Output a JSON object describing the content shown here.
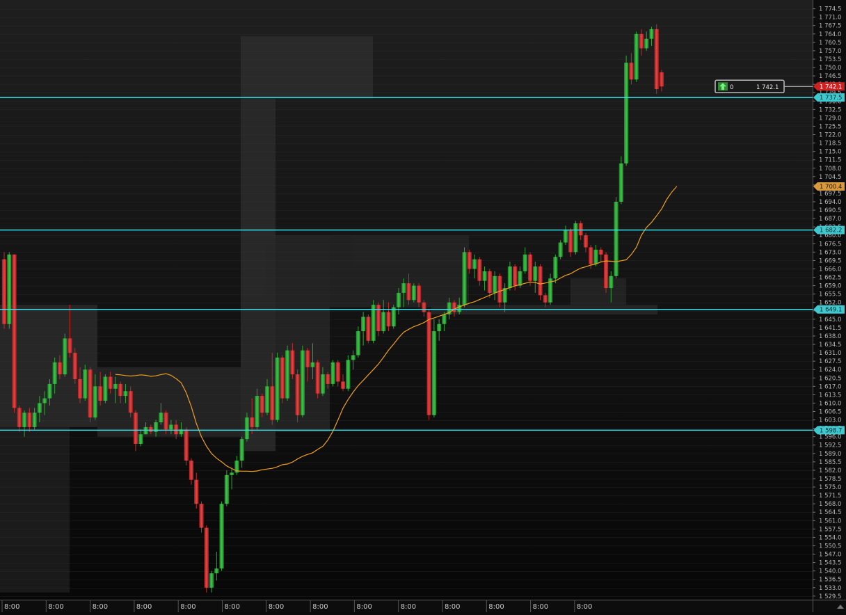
{
  "chart_data": {
    "type": "candlestick",
    "time_axis_labels": [
      "8:00",
      "8:00",
      "8:00",
      "8:00",
      "8:00",
      "8:00",
      "8:00",
      "8:00",
      "8:00",
      "8:00",
      "8:00",
      "8:00",
      "8:00",
      "8:00"
    ],
    "y_axis_ticks": [
      1774.5,
      1771.0,
      1767.5,
      1764.0,
      1760.5,
      1757.0,
      1753.5,
      1750.0,
      1746.5,
      1743.0,
      1739.5,
      1736.0,
      1732.5,
      1729.0,
      1725.5,
      1722.0,
      1718.5,
      1715.0,
      1711.5,
      1708.0,
      1704.5,
      1701.0,
      1697.5,
      1694.0,
      1690.5,
      1687.0,
      1683.5,
      1680.0,
      1676.5,
      1673.0,
      1669.5,
      1666.0,
      1662.5,
      1659.0,
      1655.5,
      1652.0,
      1648.5,
      1645.0,
      1641.5,
      1638.0,
      1634.5,
      1631.0,
      1627.5,
      1624.0,
      1620.5,
      1617.0,
      1613.5,
      1610.0,
      1606.5,
      1603.0,
      1599.5,
      1596.0,
      1592.5,
      1589.0,
      1585.5,
      1582.0,
      1578.5,
      1575.0,
      1571.5,
      1568.0,
      1564.5,
      1561.0,
      1557.5,
      1554.0,
      1550.5,
      1547.0,
      1543.5,
      1540.0,
      1536.5,
      1533.0,
      1529.5
    ],
    "ylim": [
      1528,
      1777
    ],
    "horizontal_levels": [
      1737.5,
      1682.2,
      1649.1,
      1598.7
    ],
    "horizontal_level_labels": [
      "1 737.5",
      "1 682.2",
      "1 649.1",
      "1 598.7"
    ],
    "current_price": 1742.1,
    "current_price_label": "1 742.1",
    "ma_value": 1700.4,
    "ma_value_label": "1 700.4",
    "order_widget": {
      "quantity": "0",
      "price": "1 742.1"
    },
    "colors": {
      "bull": "#27a833",
      "bear": "#d12a2a",
      "level": "#37e0e8",
      "ma": "#f0a020",
      "price_tag": "#cc2222"
    },
    "candles": [
      {
        "o": 1670,
        "h": 1673,
        "l": 1641,
        "c": 1643
      },
      {
        "o": 1643,
        "h": 1673,
        "l": 1641,
        "c": 1672
      },
      {
        "o": 1672,
        "h": 1672,
        "l": 1606,
        "c": 1608
      },
      {
        "o": 1608,
        "h": 1609,
        "l": 1598,
        "c": 1600
      },
      {
        "o": 1600,
        "h": 1607,
        "l": 1596,
        "c": 1606
      },
      {
        "o": 1606,
        "h": 1608,
        "l": 1598,
        "c": 1600
      },
      {
        "o": 1600,
        "h": 1608,
        "l": 1599,
        "c": 1606
      },
      {
        "o": 1606,
        "h": 1613,
        "l": 1602,
        "c": 1610
      },
      {
        "o": 1610,
        "h": 1615,
        "l": 1605,
        "c": 1612
      },
      {
        "o": 1612,
        "h": 1620,
        "l": 1609,
        "c": 1618
      },
      {
        "o": 1618,
        "h": 1629,
        "l": 1614,
        "c": 1627
      },
      {
        "o": 1627,
        "h": 1630,
        "l": 1620,
        "c": 1622
      },
      {
        "o": 1622,
        "h": 1639,
        "l": 1621,
        "c": 1637
      },
      {
        "o": 1637,
        "h": 1651,
        "l": 1629,
        "c": 1631
      },
      {
        "o": 1631,
        "h": 1633,
        "l": 1618,
        "c": 1620
      },
      {
        "o": 1620,
        "h": 1625,
        "l": 1610,
        "c": 1612
      },
      {
        "o": 1612,
        "h": 1626,
        "l": 1611,
        "c": 1624
      },
      {
        "o": 1624,
        "h": 1625,
        "l": 1602,
        "c": 1604
      },
      {
        "o": 1604,
        "h": 1622,
        "l": 1603,
        "c": 1617
      },
      {
        "o": 1617,
        "h": 1623,
        "l": 1609,
        "c": 1611
      },
      {
        "o": 1611,
        "h": 1622,
        "l": 1610,
        "c": 1621
      },
      {
        "o": 1621,
        "h": 1623,
        "l": 1614,
        "c": 1616
      },
      {
        "o": 1616,
        "h": 1621,
        "l": 1610,
        "c": 1618
      },
      {
        "o": 1618,
        "h": 1619,
        "l": 1610,
        "c": 1613
      },
      {
        "o": 1613,
        "h": 1618,
        "l": 1610,
        "c": 1615
      },
      {
        "o": 1615,
        "h": 1617,
        "l": 1604,
        "c": 1606
      },
      {
        "o": 1606,
        "h": 1607,
        "l": 1590,
        "c": 1593
      },
      {
        "o": 1593,
        "h": 1599,
        "l": 1592,
        "c": 1597
      },
      {
        "o": 1597,
        "h": 1602,
        "l": 1597,
        "c": 1600
      },
      {
        "o": 1600,
        "h": 1601,
        "l": 1597,
        "c": 1598
      },
      {
        "o": 1598,
        "h": 1603,
        "l": 1596,
        "c": 1602
      },
      {
        "o": 1602,
        "h": 1610,
        "l": 1601,
        "c": 1606
      },
      {
        "o": 1606,
        "h": 1607,
        "l": 1597,
        "c": 1599
      },
      {
        "o": 1599,
        "h": 1603,
        "l": 1597,
        "c": 1601
      },
      {
        "o": 1601,
        "h": 1603,
        "l": 1595,
        "c": 1597
      },
      {
        "o": 1597,
        "h": 1602,
        "l": 1596,
        "c": 1599
      },
      {
        "o": 1599,
        "h": 1600,
        "l": 1584,
        "c": 1586
      },
      {
        "o": 1586,
        "h": 1587,
        "l": 1576,
        "c": 1578
      },
      {
        "o": 1578,
        "h": 1581,
        "l": 1566,
        "c": 1568
      },
      {
        "o": 1568,
        "h": 1569,
        "l": 1556,
        "c": 1558
      },
      {
        "o": 1558,
        "h": 1559,
        "l": 1531,
        "c": 1533
      },
      {
        "o": 1533,
        "h": 1540,
        "l": 1531,
        "c": 1539
      },
      {
        "o": 1539,
        "h": 1548,
        "l": 1536,
        "c": 1541
      },
      {
        "o": 1541,
        "h": 1569,
        "l": 1540,
        "c": 1568
      },
      {
        "o": 1568,
        "h": 1582,
        "l": 1567,
        "c": 1580
      },
      {
        "o": 1580,
        "h": 1583,
        "l": 1574,
        "c": 1581
      },
      {
        "o": 1581,
        "h": 1588,
        "l": 1580,
        "c": 1586
      },
      {
        "o": 1586,
        "h": 1596,
        "l": 1583,
        "c": 1595
      },
      {
        "o": 1595,
        "h": 1606,
        "l": 1594,
        "c": 1604
      },
      {
        "o": 1604,
        "h": 1612,
        "l": 1597,
        "c": 1600
      },
      {
        "o": 1600,
        "h": 1616,
        "l": 1599,
        "c": 1613
      },
      {
        "o": 1613,
        "h": 1614,
        "l": 1604,
        "c": 1606
      },
      {
        "o": 1606,
        "h": 1620,
        "l": 1605,
        "c": 1617
      },
      {
        "o": 1617,
        "h": 1631,
        "l": 1601,
        "c": 1603
      },
      {
        "o": 1603,
        "h": 1631,
        "l": 1602,
        "c": 1629
      },
      {
        "o": 1629,
        "h": 1630,
        "l": 1610,
        "c": 1612
      },
      {
        "o": 1612,
        "h": 1634,
        "l": 1611,
        "c": 1632
      },
      {
        "o": 1632,
        "h": 1635,
        "l": 1620,
        "c": 1622
      },
      {
        "o": 1622,
        "h": 1624,
        "l": 1602,
        "c": 1605
      },
      {
        "o": 1605,
        "h": 1634,
        "l": 1604,
        "c": 1632
      },
      {
        "o": 1632,
        "h": 1633,
        "l": 1619,
        "c": 1625
      },
      {
        "o": 1625,
        "h": 1635,
        "l": 1620,
        "c": 1627
      },
      {
        "o": 1627,
        "h": 1628,
        "l": 1612,
        "c": 1614
      },
      {
        "o": 1614,
        "h": 1625,
        "l": 1613,
        "c": 1622
      },
      {
        "o": 1622,
        "h": 1623,
        "l": 1616,
        "c": 1618
      },
      {
        "o": 1618,
        "h": 1628,
        "l": 1617,
        "c": 1627
      },
      {
        "o": 1627,
        "h": 1628,
        "l": 1617,
        "c": 1619
      },
      {
        "o": 1619,
        "h": 1622,
        "l": 1615,
        "c": 1616
      },
      {
        "o": 1616,
        "h": 1630,
        "l": 1615,
        "c": 1628
      },
      {
        "o": 1628,
        "h": 1632,
        "l": 1624,
        "c": 1630
      },
      {
        "o": 1630,
        "h": 1642,
        "l": 1629,
        "c": 1640
      },
      {
        "o": 1640,
        "h": 1648,
        "l": 1634,
        "c": 1646
      },
      {
        "o": 1646,
        "h": 1647,
        "l": 1635,
        "c": 1636
      },
      {
        "o": 1636,
        "h": 1653,
        "l": 1635,
        "c": 1651
      },
      {
        "o": 1651,
        "h": 1652,
        "l": 1638,
        "c": 1640
      },
      {
        "o": 1640,
        "h": 1653,
        "l": 1639,
        "c": 1648
      },
      {
        "o": 1648,
        "h": 1652,
        "l": 1640,
        "c": 1642
      },
      {
        "o": 1642,
        "h": 1651,
        "l": 1641,
        "c": 1650
      },
      {
        "o": 1650,
        "h": 1658,
        "l": 1647,
        "c": 1656
      },
      {
        "o": 1656,
        "h": 1662,
        "l": 1650,
        "c": 1660
      },
      {
        "o": 1660,
        "h": 1664,
        "l": 1651,
        "c": 1653
      },
      {
        "o": 1653,
        "h": 1660,
        "l": 1652,
        "c": 1659
      },
      {
        "o": 1659,
        "h": 1660,
        "l": 1650,
        "c": 1652
      },
      {
        "o": 1652,
        "h": 1653,
        "l": 1646,
        "c": 1648
      },
      {
        "o": 1648,
        "h": 1649,
        "l": 1603,
        "c": 1605
      },
      {
        "o": 1605,
        "h": 1645,
        "l": 1604,
        "c": 1640
      },
      {
        "o": 1640,
        "h": 1645,
        "l": 1636,
        "c": 1643
      },
      {
        "o": 1643,
        "h": 1648,
        "l": 1640,
        "c": 1647
      },
      {
        "o": 1647,
        "h": 1654,
        "l": 1645,
        "c": 1652
      },
      {
        "o": 1652,
        "h": 1653,
        "l": 1646,
        "c": 1648
      },
      {
        "o": 1648,
        "h": 1654,
        "l": 1647,
        "c": 1651
      },
      {
        "o": 1651,
        "h": 1675,
        "l": 1650,
        "c": 1673
      },
      {
        "o": 1673,
        "h": 1674,
        "l": 1664,
        "c": 1666
      },
      {
        "o": 1666,
        "h": 1672,
        "l": 1662,
        "c": 1670
      },
      {
        "o": 1670,
        "h": 1671,
        "l": 1659,
        "c": 1661
      },
      {
        "o": 1661,
        "h": 1667,
        "l": 1657,
        "c": 1665
      },
      {
        "o": 1665,
        "h": 1666,
        "l": 1654,
        "c": 1656
      },
      {
        "o": 1656,
        "h": 1665,
        "l": 1653,
        "c": 1663
      },
      {
        "o": 1663,
        "h": 1664,
        "l": 1650,
        "c": 1652
      },
      {
        "o": 1652,
        "h": 1660,
        "l": 1648,
        "c": 1658
      },
      {
        "o": 1658,
        "h": 1669,
        "l": 1657,
        "c": 1667
      },
      {
        "o": 1667,
        "h": 1668,
        "l": 1657,
        "c": 1659
      },
      {
        "o": 1659,
        "h": 1667,
        "l": 1658,
        "c": 1665
      },
      {
        "o": 1665,
        "h": 1675,
        "l": 1664,
        "c": 1672
      },
      {
        "o": 1672,
        "h": 1673,
        "l": 1659,
        "c": 1661
      },
      {
        "o": 1661,
        "h": 1669,
        "l": 1656,
        "c": 1667
      },
      {
        "o": 1667,
        "h": 1668,
        "l": 1653,
        "c": 1655
      },
      {
        "o": 1655,
        "h": 1656,
        "l": 1650,
        "c": 1652
      },
      {
        "o": 1652,
        "h": 1664,
        "l": 1651,
        "c": 1662
      },
      {
        "o": 1662,
        "h": 1672,
        "l": 1660,
        "c": 1671
      },
      {
        "o": 1671,
        "h": 1678,
        "l": 1670,
        "c": 1677
      },
      {
        "o": 1677,
        "h": 1684,
        "l": 1676,
        "c": 1682
      },
      {
        "o": 1682,
        "h": 1683,
        "l": 1671,
        "c": 1673
      },
      {
        "o": 1673,
        "h": 1686,
        "l": 1672,
        "c": 1685
      },
      {
        "o": 1685,
        "h": 1686,
        "l": 1678,
        "c": 1680
      },
      {
        "o": 1680,
        "h": 1681,
        "l": 1673,
        "c": 1675
      },
      {
        "o": 1675,
        "h": 1676,
        "l": 1666,
        "c": 1668
      },
      {
        "o": 1668,
        "h": 1676,
        "l": 1667,
        "c": 1674
      },
      {
        "o": 1674,
        "h": 1675,
        "l": 1669,
        "c": 1672
      },
      {
        "o": 1672,
        "h": 1673,
        "l": 1656,
        "c": 1658
      },
      {
        "o": 1658,
        "h": 1665,
        "l": 1652,
        "c": 1663
      },
      {
        "o": 1663,
        "h": 1696,
        "l": 1662,
        "c": 1694
      },
      {
        "o": 1694,
        "h": 1713,
        "l": 1693,
        "c": 1710
      },
      {
        "o": 1710,
        "h": 1755,
        "l": 1709,
        "c": 1752
      },
      {
        "o": 1752,
        "h": 1756,
        "l": 1743,
        "c": 1745
      },
      {
        "o": 1745,
        "h": 1765,
        "l": 1744,
        "c": 1764
      },
      {
        "o": 1764,
        "h": 1766,
        "l": 1755,
        "c": 1758
      },
      {
        "o": 1758,
        "h": 1765,
        "l": 1757,
        "c": 1762
      },
      {
        "o": 1762,
        "h": 1767,
        "l": 1759,
        "c": 1766
      },
      {
        "o": 1766,
        "h": 1768,
        "l": 1739,
        "c": 1741
      },
      {
        "o": 1748,
        "h": 1749,
        "l": 1740,
        "c": 1742.1
      }
    ],
    "ma_series": [
      null,
      null,
      null,
      null,
      null,
      null,
      null,
      null,
      null,
      null,
      null,
      null,
      null,
      null,
      null,
      null,
      null,
      null,
      null,
      null,
      null,
      null,
      1622.0,
      1621.8,
      1621.5,
      1621.3,
      1621.5,
      1621.8,
      1621.6,
      1621.2,
      1621.4,
      1621.9,
      1622.3,
      1621.6,
      1620.2,
      1618.5,
      1614.3,
      1608.5,
      1601.5,
      1596.0,
      1592.0,
      1589.0,
      1587.0,
      1585.5,
      1583.8,
      1582.7,
      1581.7,
      1581.6,
      1581.6,
      1581.5,
      1581.7,
      1582.2,
      1582.5,
      1582.8,
      1583.4,
      1584.3,
      1584.6,
      1585.4,
      1586.7,
      1587.8,
      1588.6,
      1589.3,
      1590.7,
      1592.0,
      1594.6,
      1598.3,
      1603.0,
      1607.9,
      1611.5,
      1614.6,
      1617.3,
      1619.5,
      1621.8,
      1624.0,
      1626.3,
      1629.1,
      1632.1,
      1634.6,
      1637.3,
      1639.6,
      1640.8,
      1641.9,
      1642.7,
      1643.6,
      1644.9,
      1645.5,
      1646.3,
      1647.0,
      1647.8,
      1649.2,
      1650.2,
      1650.9,
      1651.7,
      1652.3,
      1653.2,
      1654.1,
      1655.0,
      1655.9,
      1656.7,
      1657.4,
      1658.2,
      1658.9,
      1659.4,
      1660.0,
      1660.5,
      1660.3,
      1659.7,
      1660.1,
      1660.6,
      1661.0,
      1662.2,
      1663.3,
      1664.0,
      1665.2,
      1666.3,
      1666.9,
      1667.6,
      1668.0,
      1668.9,
      1669.3,
      1669.2,
      1669.0,
      1669.4,
      1669.8,
      1672.0,
      1675.0,
      1680.0,
      1683.3,
      1685.4,
      1688.1,
      1691.0,
      1695.0,
      1698.0,
      1700.4
    ]
  }
}
